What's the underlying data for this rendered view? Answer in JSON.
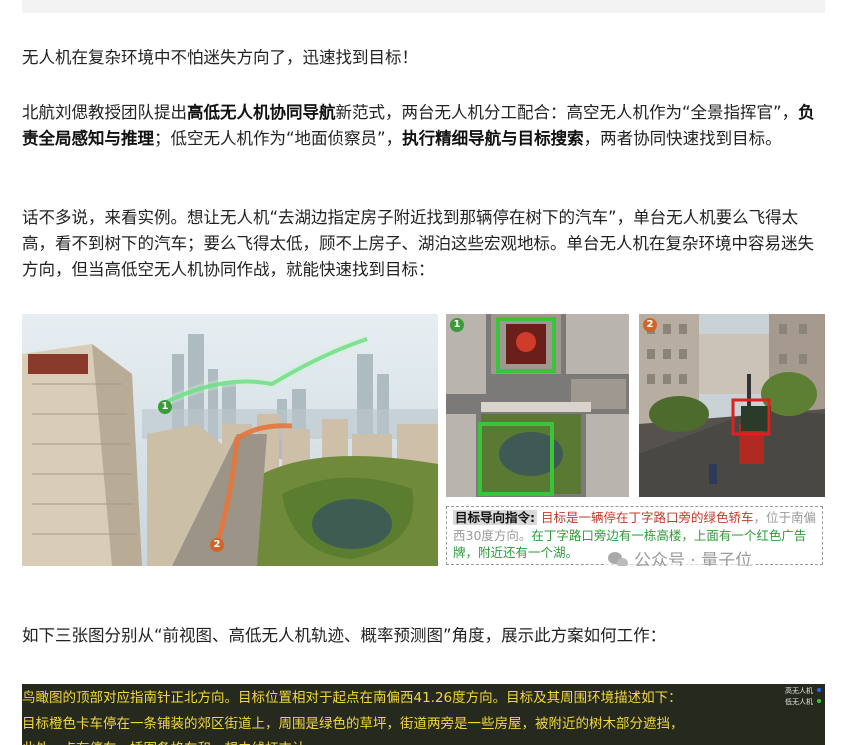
{
  "paragraphs": {
    "p1": "无人机在复杂环境中不怕迷失方向了，迅速找到目标！",
    "p2": [
      {
        "text": "北航刘偲教授团队提出",
        "bold": false
      },
      {
        "text": "高低无人机协同导航",
        "bold": true
      },
      {
        "text": "新范式，两台无人机分工配合：高空无人机作为“全景指挥官”，",
        "bold": false
      },
      {
        "text": "负责全局感知与推理",
        "bold": true
      },
      {
        "text": "；低空无人机作为“地面侦察员”，",
        "bold": false
      },
      {
        "text": "执行精细导航与目标搜索",
        "bold": true
      },
      {
        "text": "，两者协同快速找到目标。",
        "bold": false
      }
    ],
    "p3": "话不多说，来看实例。想让无人机“去湖边指定房子附近找到那辆停在树下的汽车”，单台无人机要么飞得太高，看不到树下的汽车；要么飞得太低，顾不上房子、湖泊这些宏观地标。单台无人机在复杂环境中容易迷失方向，但当高低空无人机协同作战，就能快速找到目标：",
    "p4": "如下三张图分别从“前视图、高低无人机轨迹、概率预测图”角度，展示此方案如何工作："
  },
  "figure": {
    "badges": [
      "1",
      "2",
      "1",
      "2"
    ],
    "instruction": {
      "label": "目标导向指令:",
      "red": "目标是一辆停在丁字路口旁的绿色轿车",
      "grey": "，位于南偏西30度方向。",
      "green": "在丁字路口旁边有一栋高楼，上面有一个红色广告牌，附近还有一个湖。"
    },
    "watermark": "公众号 · 量子位"
  },
  "bottom_image": {
    "line1": "鸟瞰图的顶部对应指南针正北方向。目标位置相对于起点在南偏西41.26度方向。目标及其周围环境描述如下：",
    "line2": "目标橙色卡车停在一条铺装的郊区街道上，周围是绿色的草坪，街道两旁是一些房屋，被附近的树木部分遮挡，",
    "line3": "此外，点有停车，插图备格车和，想由线杆支认",
    "legend": [
      {
        "label": "高无人机",
        "color": "#2a62ff"
      },
      {
        "label": "低无人机",
        "color": "#33cc33"
      }
    ]
  },
  "colors": {
    "high_drone_path": "#3fd25a",
    "low_drone_path": "#e8743a",
    "target_box_red": "#e02020",
    "target_box_green": "#39c439",
    "caption_yellow": "#f2d83b"
  }
}
